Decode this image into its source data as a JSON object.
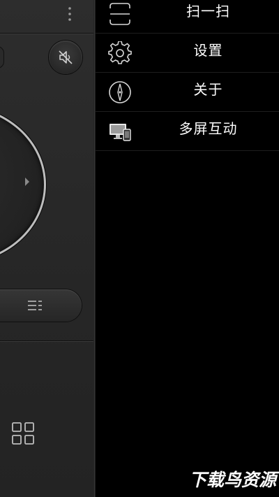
{
  "drawer": {
    "items": [
      {
        "label": "扫一扫",
        "icon": "scan-icon"
      },
      {
        "label": "设置",
        "icon": "gear-icon"
      },
      {
        "label": "关于",
        "icon": "compass-icon"
      },
      {
        "label": "多屏互动",
        "icon": "multi-screen-icon"
      }
    ]
  },
  "remote": {
    "icons": [
      "more-vertical-icon",
      "mute-icon",
      "chevron-right-icon",
      "menu-lines-icon",
      "grid-icon"
    ]
  },
  "watermark": {
    "text": "下载鸟资源"
  },
  "colors": {
    "background": "#000000",
    "panel": "#2a2a2a",
    "ring": "#bdbdbd",
    "text": "#ffffff"
  }
}
